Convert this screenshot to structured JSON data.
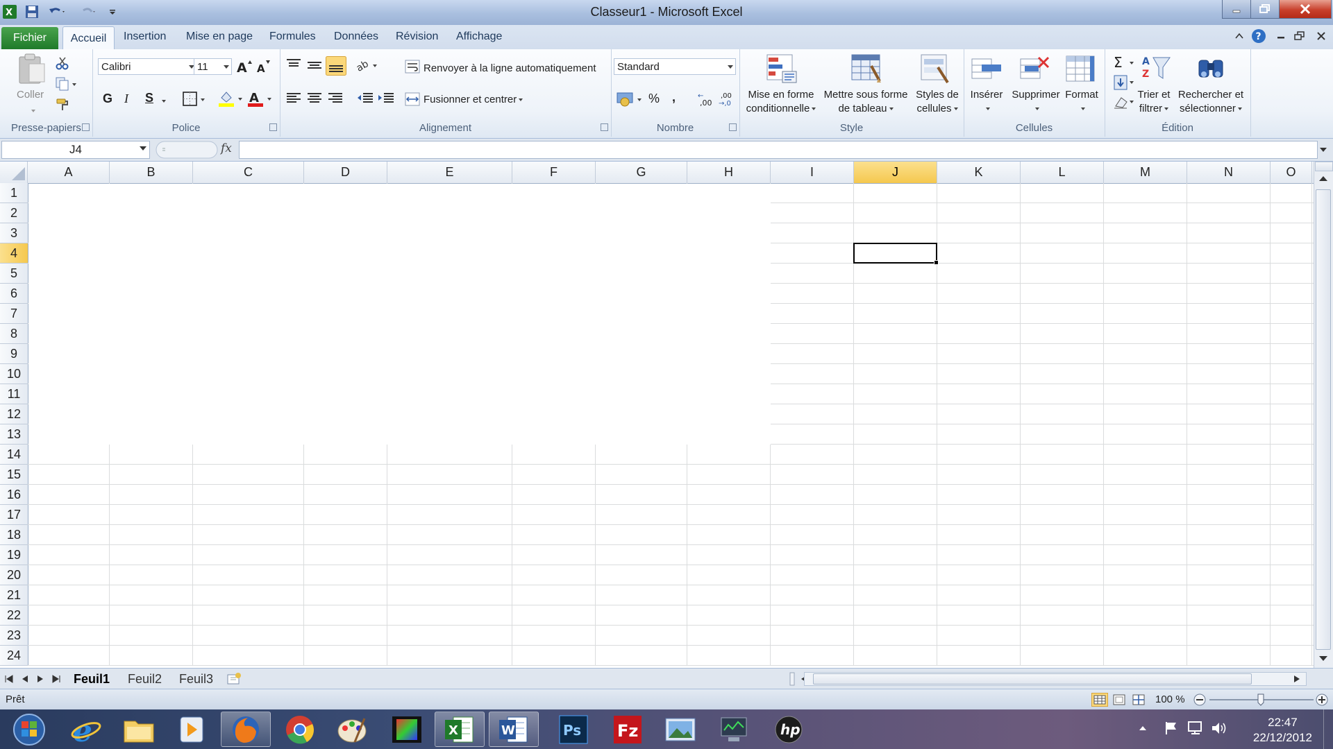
{
  "window": {
    "title": "Classeur1 - Microsoft Excel"
  },
  "ribbon_tabs": [
    "Fichier",
    "Accueil",
    "Insertion",
    "Mise en page",
    "Formules",
    "Données",
    "Révision",
    "Affichage"
  ],
  "clipboard": {
    "paste_label": "Coller",
    "group_label": "Presse-papiers"
  },
  "font": {
    "name": "Calibri",
    "size": "11",
    "bold": "G",
    "italic": "I",
    "underline": "S",
    "group_label": "Police"
  },
  "alignment": {
    "wrap_label": "Renvoyer à la ligne automatiquement",
    "merge_label": "Fusionner et centrer",
    "group_label": "Alignement"
  },
  "number": {
    "format": "Standard",
    "percent": "%",
    "comma": ",",
    "group_label": "Nombre"
  },
  "style": {
    "cond_format_line1": "Mise en forme",
    "cond_format_line2": "conditionnelle",
    "table_line1": "Mettre sous forme",
    "table_line2": "de tableau",
    "cell_styles_line1": "Styles de",
    "cell_styles_line2": "cellules",
    "group_label": "Style"
  },
  "cells_group": {
    "insert": "Insérer",
    "delete": "Supprimer",
    "format": "Format",
    "group_label": "Cellules"
  },
  "editing": {
    "sort_line1": "Trier et",
    "sort_line2": "filtrer",
    "find_line1": "Rechercher et",
    "find_line2": "sélectionner",
    "group_label": "Édition"
  },
  "formula_bar": {
    "name_box": "J4",
    "fx": "fx",
    "value": ""
  },
  "columns": [
    "A",
    "B",
    "C",
    "D",
    "E",
    "F",
    "G",
    "H",
    "I",
    "J",
    "K",
    "L",
    "M",
    "N",
    "O"
  ],
  "rows": [
    "1",
    "2",
    "3",
    "4",
    "5",
    "6",
    "7",
    "8",
    "9",
    "10",
    "11",
    "12",
    "13",
    "14",
    "15",
    "16",
    "17",
    "18",
    "19",
    "20",
    "21",
    "22",
    "23",
    "24"
  ],
  "selection": {
    "column": "J",
    "row": "4"
  },
  "sheets": [
    "Feuil1",
    "Feuil2",
    "Feuil3"
  ],
  "active_sheet": "Feuil1",
  "status": {
    "ready": "Prêt",
    "zoom": "100 %"
  },
  "taskbar": {
    "time": "22:47",
    "date": "22/12/2012"
  },
  "colors": {
    "accent_selection": "#f5c84e",
    "file_tab": "#1f7a2a"
  }
}
